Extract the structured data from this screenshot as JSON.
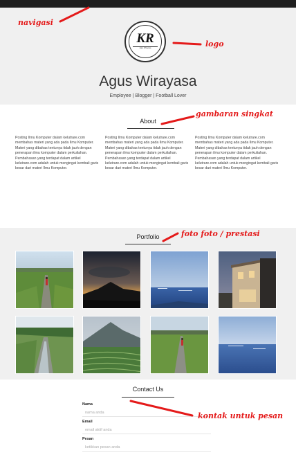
{
  "header": {
    "logo_text": "KR",
    "logo_subtext": "Agus Wirayasa",
    "site_name": "Agus Wirayasa",
    "tagline": "Employee | Blogger | Football Lover"
  },
  "about": {
    "title": "About",
    "columns": [
      "Posting Ilmu Komputer dalam kelutrare.com membahas materi yang ada pada Ilmu Komputer. Materi yang dibahas tentunya tidak jauh dengan penerapan ilmu komputer dalam perkuliahan. Pembahasan yang terdapat dalam artikel kelutrare.com adalah untuk mengingat kembali garis besar dari materi Ilmu Komputer.",
      "Posting Ilmu Komputer dalam kelutrare.com membahas materi yang ada pada Ilmu Komputer. Materi yang dibahas tentunya tidak jauh dengan penerapan ilmu komputer dalam perkuliahan. Pembahasan yang terdapat dalam artikel kelutrare.com adalah untuk mengingat kembali garis besar dari materi Ilmu Komputer.",
      "Posting Ilmu Komputer dalam kelutrare.com membahas materi yang ada pada Ilmu Komputer. Materi yang dibahas tentunya tidak jauh dengan penerapan ilmu komputer dalam perkuliahan. Pembahasan yang terdapat dalam artikel kelutrare.com adalah untuk mengingat kembali garis besar dari materi Ilmu Komputer."
    ]
  },
  "portfolio": {
    "title": "Portfolio"
  },
  "contact": {
    "title": "Contact Us",
    "fields": [
      {
        "label": "Nama",
        "placeholder": "nama anda"
      },
      {
        "label": "Email",
        "placeholder": "email aktif anda"
      },
      {
        "label": "Pesan",
        "placeholder": "ketikkan pesan anda"
      }
    ]
  },
  "annotations": {
    "navigasi": "navigasi",
    "logo": "logo",
    "gambaran": "gambaran singkat",
    "foto": "foto foto / prestasi",
    "kontak": "kontak untuk pesan"
  },
  "colors": {
    "topbar": "#1e1e1e",
    "section_gray": "#f0f0f0",
    "annotation_red": "#e41a1a"
  }
}
